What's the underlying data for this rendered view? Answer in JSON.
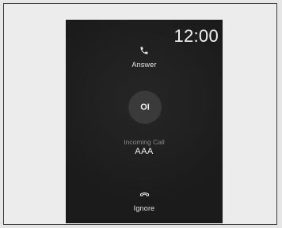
{
  "screen": {
    "clock": "12:00",
    "answer": {
      "label": "Answer",
      "icon": "phone-icon"
    },
    "avatar": {
      "initials": "OI"
    },
    "status_text": "Incoming Call",
    "caller_name": "AAA",
    "ignore": {
      "label": "Ignore",
      "icon": "hang-up-icon"
    }
  },
  "colors": {
    "screen_background": "#1e1e1e",
    "avatar_background": "#3a3a3a",
    "primary_text": "#f2f2f2",
    "secondary_text": "#8a8a8a"
  }
}
